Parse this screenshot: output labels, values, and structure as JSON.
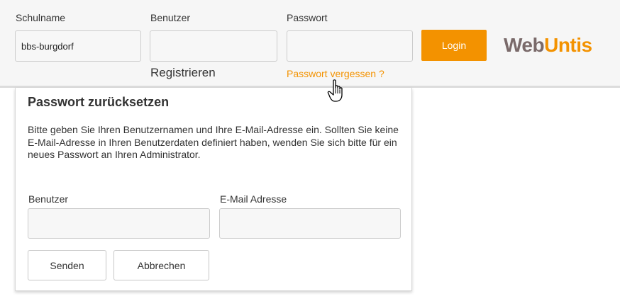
{
  "header": {
    "school_label": "Schulname",
    "school_value": "bbs-burgdorf",
    "user_label": "Benutzer",
    "user_value": "",
    "password_label": "Passwort",
    "password_value": "",
    "login_label": "Login",
    "register_label": "Registrieren",
    "forgot_label": "Passwort vergessen ?",
    "logo": {
      "part1": "Web",
      "part2": "Untis"
    }
  },
  "reset_panel": {
    "title": "Passwort zurücksetzen",
    "description": "Bitte geben Sie Ihren Benutzernamen und Ihre E-Mail-Adresse ein. Sollten Sie keine E-Mail-Adresse in Ihren Benutzerdaten definiert haben, wenden Sie sich bitte für ein neues Passwort an Ihren Administrator.",
    "user_label": "Benutzer",
    "user_value": "",
    "email_label": "E-Mail Adresse",
    "email_value": "",
    "send_label": "Senden",
    "cancel_label": "Abbrechen"
  },
  "colors": {
    "accent": "#f39200",
    "logo_dark": "#7a6a6a",
    "topbar_bg": "#f6f6f6"
  },
  "icons": {
    "cursor": "hand-pointer-cursor-icon"
  }
}
